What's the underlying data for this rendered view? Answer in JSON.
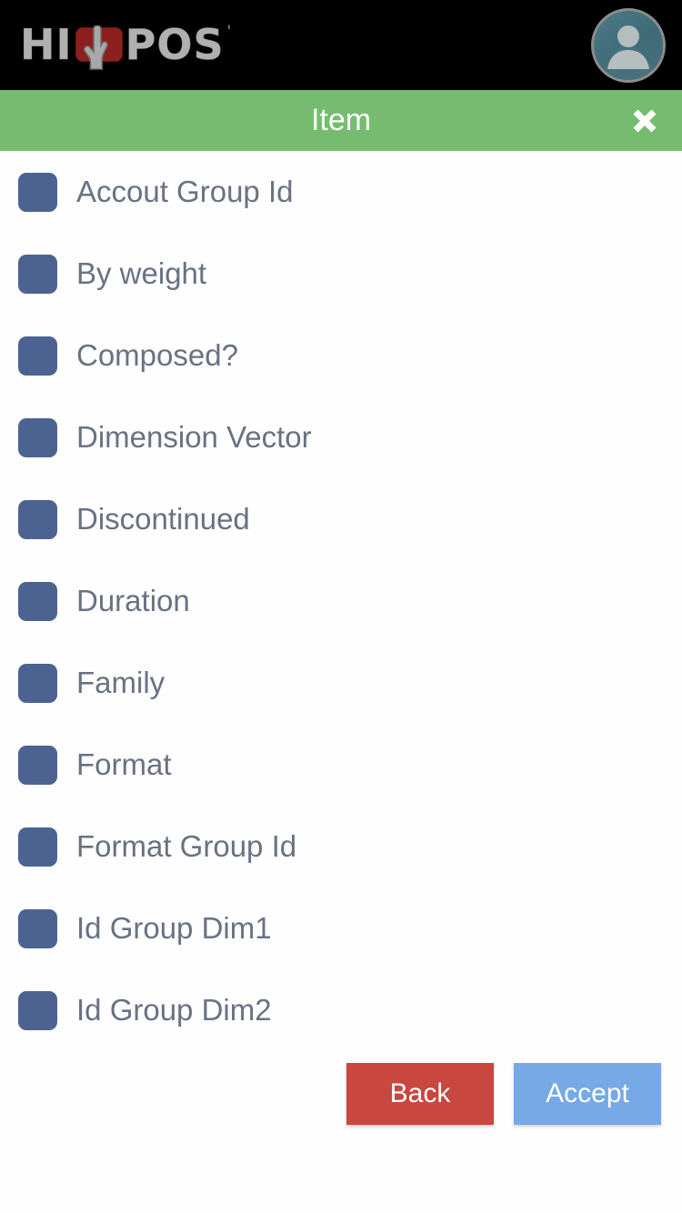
{
  "header": {
    "logo": {
      "part1": "HI",
      "part2": "POS",
      "registered_mark": "'",
      "box_icon": "hand-pointer-icon",
      "box_color": "#8e1f1f",
      "text_color": "#b0b0b0"
    },
    "avatar": {
      "icon": "user-avatar-icon",
      "background_color": "#456f7c",
      "border_color": "#8c8c8c"
    },
    "background_color": "#000000"
  },
  "titlebar": {
    "title": "Item",
    "background_color": "#76bc70",
    "close_icon": "close-icon",
    "close_label": "✕"
  },
  "list": {
    "checkbox_color": "#4c6392",
    "label_color": "#697283",
    "items": [
      {
        "label": "Accout Group Id",
        "checked": false
      },
      {
        "label": "By weight",
        "checked": false
      },
      {
        "label": "Composed?",
        "checked": false
      },
      {
        "label": "Dimension Vector",
        "checked": false
      },
      {
        "label": "Discontinued",
        "checked": false
      },
      {
        "label": "Duration",
        "checked": false
      },
      {
        "label": "Family",
        "checked": false
      },
      {
        "label": "Format",
        "checked": false
      },
      {
        "label": "Format Group Id",
        "checked": false
      },
      {
        "label": "Id Group Dim1",
        "checked": false
      },
      {
        "label": "Id Group Dim2",
        "checked": false
      }
    ]
  },
  "footer": {
    "back_label": "Back",
    "back_color": "#c8473f",
    "accept_label": "Accept",
    "accept_color": "#76a9e6"
  }
}
